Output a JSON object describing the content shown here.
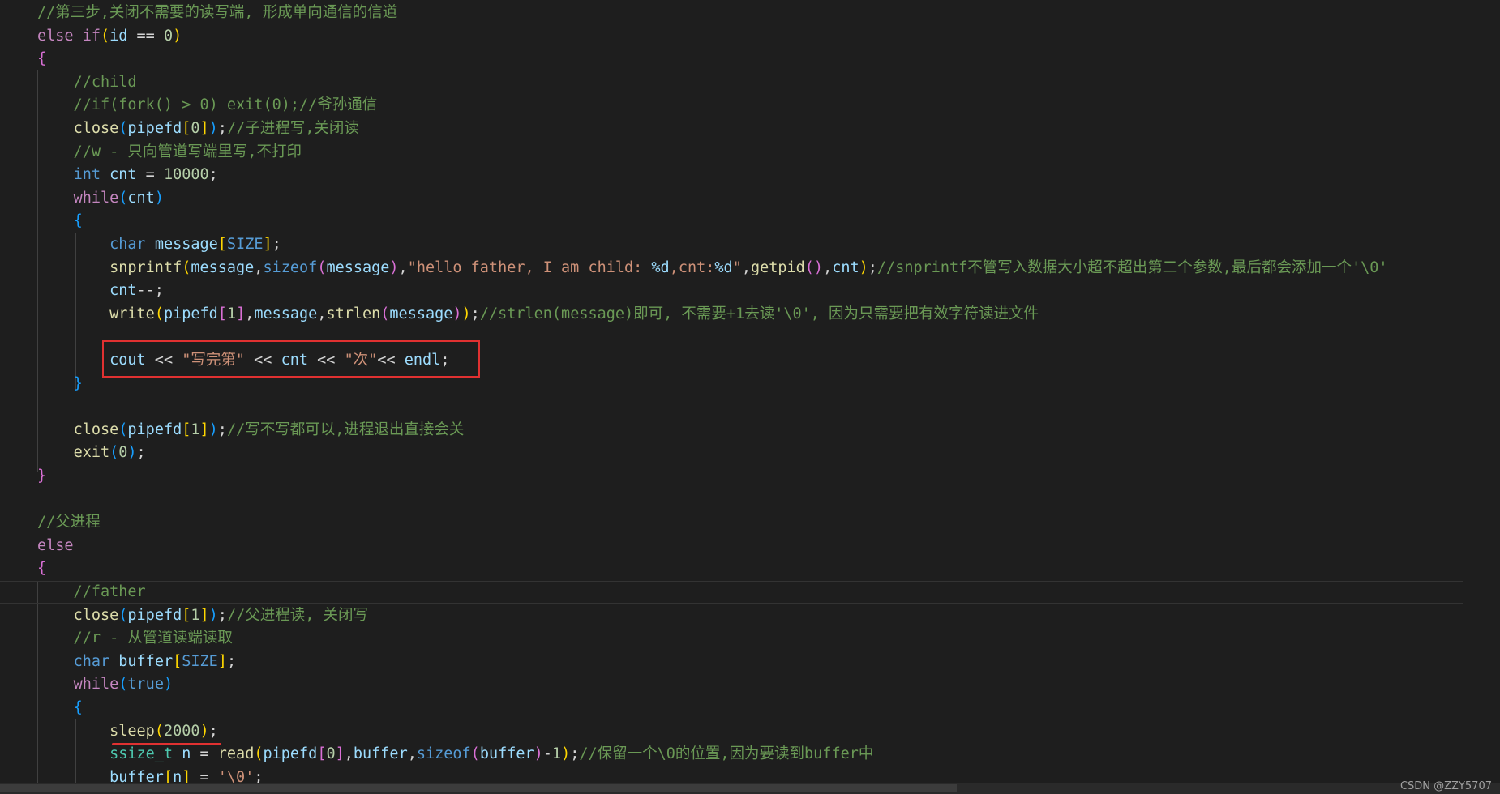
{
  "lines": [
    [
      {
        "t": "//第三步,关闭不需要的读写端, 形成单向通信的信道",
        "c": "comment"
      }
    ],
    [
      {
        "t": "else ",
        "c": "control"
      },
      {
        "t": "if",
        "c": "control"
      },
      {
        "t": "(",
        "c": "b1"
      },
      {
        "t": "id",
        "c": "var"
      },
      {
        "t": " == ",
        "c": "plain"
      },
      {
        "t": "0",
        "c": "number"
      },
      {
        "t": ")",
        "c": "b1"
      }
    ],
    [
      {
        "t": "{",
        "c": "b2"
      }
    ],
    [
      {
        "t": "    //child",
        "c": "comment"
      }
    ],
    [
      {
        "t": "    //if(fork() > 0) exit(0);//爷孙通信",
        "c": "comment"
      }
    ],
    [
      {
        "t": "    ",
        "c": "plain"
      },
      {
        "t": "close",
        "c": "func"
      },
      {
        "t": "(",
        "c": "b3"
      },
      {
        "t": "pipefd",
        "c": "var"
      },
      {
        "t": "[",
        "c": "b1"
      },
      {
        "t": "0",
        "c": "number"
      },
      {
        "t": "]",
        "c": "b1"
      },
      {
        "t": ")",
        "c": "b3"
      },
      {
        "t": ";",
        "c": "plain"
      },
      {
        "t": "//子进程写,关闭读",
        "c": "comment"
      }
    ],
    [
      {
        "t": "    //w - 只向管道写端里写,不打印",
        "c": "comment"
      }
    ],
    [
      {
        "t": "    ",
        "c": "plain"
      },
      {
        "t": "int",
        "c": "keyword"
      },
      {
        "t": " ",
        "c": "plain"
      },
      {
        "t": "cnt",
        "c": "var"
      },
      {
        "t": " = ",
        "c": "plain"
      },
      {
        "t": "10000",
        "c": "number"
      },
      {
        "t": ";",
        "c": "plain"
      }
    ],
    [
      {
        "t": "    ",
        "c": "plain"
      },
      {
        "t": "while",
        "c": "control"
      },
      {
        "t": "(",
        "c": "b3"
      },
      {
        "t": "cnt",
        "c": "var"
      },
      {
        "t": ")",
        "c": "b3"
      }
    ],
    [
      {
        "t": "    ",
        "c": "plain"
      },
      {
        "t": "{",
        "c": "b3"
      }
    ],
    [
      {
        "t": "        ",
        "c": "plain"
      },
      {
        "t": "char",
        "c": "keyword"
      },
      {
        "t": " ",
        "c": "plain"
      },
      {
        "t": "message",
        "c": "var"
      },
      {
        "t": "[",
        "c": "b1"
      },
      {
        "t": "SIZE",
        "c": "keyword"
      },
      {
        "t": "]",
        "c": "b1"
      },
      {
        "t": ";",
        "c": "plain"
      }
    ],
    [
      {
        "t": "        ",
        "c": "plain"
      },
      {
        "t": "snprintf",
        "c": "func"
      },
      {
        "t": "(",
        "c": "b1"
      },
      {
        "t": "message",
        "c": "var"
      },
      {
        "t": ",",
        "c": "plain"
      },
      {
        "t": "sizeof",
        "c": "keyword"
      },
      {
        "t": "(",
        "c": "b2"
      },
      {
        "t": "message",
        "c": "var"
      },
      {
        "t": ")",
        "c": "b2"
      },
      {
        "t": ",",
        "c": "plain"
      },
      {
        "t": "\"hello father, I am child: ",
        "c": "string"
      },
      {
        "t": "%d",
        "c": "fmt"
      },
      {
        "t": ",cnt:",
        "c": "string"
      },
      {
        "t": "%d",
        "c": "fmt"
      },
      {
        "t": "\"",
        "c": "string"
      },
      {
        "t": ",",
        "c": "plain"
      },
      {
        "t": "getpid",
        "c": "func"
      },
      {
        "t": "()",
        "c": "b2"
      },
      {
        "t": ",",
        "c": "plain"
      },
      {
        "t": "cnt",
        "c": "var"
      },
      {
        "t": ")",
        "c": "b1"
      },
      {
        "t": ";",
        "c": "plain"
      },
      {
        "t": "//snprintf不管写入数据大小超不超出第二个参数,最后都会添加一个'\\0'",
        "c": "comment"
      }
    ],
    [
      {
        "t": "        ",
        "c": "plain"
      },
      {
        "t": "cnt",
        "c": "var"
      },
      {
        "t": "--;",
        "c": "plain"
      }
    ],
    [
      {
        "t": "        ",
        "c": "plain"
      },
      {
        "t": "write",
        "c": "func"
      },
      {
        "t": "(",
        "c": "b1"
      },
      {
        "t": "pipefd",
        "c": "var"
      },
      {
        "t": "[",
        "c": "b2"
      },
      {
        "t": "1",
        "c": "number"
      },
      {
        "t": "]",
        "c": "b2"
      },
      {
        "t": ",",
        "c": "plain"
      },
      {
        "t": "message",
        "c": "var"
      },
      {
        "t": ",",
        "c": "plain"
      },
      {
        "t": "strlen",
        "c": "func"
      },
      {
        "t": "(",
        "c": "b2"
      },
      {
        "t": "message",
        "c": "var"
      },
      {
        "t": ")",
        "c": "b2"
      },
      {
        "t": ")",
        "c": "b1"
      },
      {
        "t": ";",
        "c": "plain"
      },
      {
        "t": "//strlen(message)即可, 不需要+1去读'\\0', 因为只需要把有效字符读进文件",
        "c": "comment"
      }
    ],
    [],
    [
      {
        "t": "        ",
        "c": "plain"
      },
      {
        "t": "cout",
        "c": "var"
      },
      {
        "t": " << ",
        "c": "plain"
      },
      {
        "t": "\"写完第\"",
        "c": "string"
      },
      {
        "t": " << ",
        "c": "plain"
      },
      {
        "t": "cnt",
        "c": "var"
      },
      {
        "t": " << ",
        "c": "plain"
      },
      {
        "t": "\"次\"",
        "c": "string"
      },
      {
        "t": "<< ",
        "c": "plain"
      },
      {
        "t": "endl",
        "c": "var"
      },
      {
        "t": ";",
        "c": "plain"
      }
    ],
    [
      {
        "t": "    ",
        "c": "plain"
      },
      {
        "t": "}",
        "c": "b3"
      }
    ],
    [],
    [
      {
        "t": "    ",
        "c": "plain"
      },
      {
        "t": "close",
        "c": "func"
      },
      {
        "t": "(",
        "c": "b3"
      },
      {
        "t": "pipefd",
        "c": "var"
      },
      {
        "t": "[",
        "c": "b1"
      },
      {
        "t": "1",
        "c": "number"
      },
      {
        "t": "]",
        "c": "b1"
      },
      {
        "t": ")",
        "c": "b3"
      },
      {
        "t": ";",
        "c": "plain"
      },
      {
        "t": "//写不写都可以,进程退出直接会关",
        "c": "comment"
      }
    ],
    [
      {
        "t": "    ",
        "c": "plain"
      },
      {
        "t": "exit",
        "c": "func"
      },
      {
        "t": "(",
        "c": "b3"
      },
      {
        "t": "0",
        "c": "number"
      },
      {
        "t": ")",
        "c": "b3"
      },
      {
        "t": ";",
        "c": "plain"
      }
    ],
    [
      {
        "t": "}",
        "c": "b2"
      }
    ],
    [],
    [
      {
        "t": "//父进程",
        "c": "comment"
      }
    ],
    [
      {
        "t": "else",
        "c": "control"
      }
    ],
    [
      {
        "t": "{",
        "c": "b2"
      }
    ],
    [
      {
        "t": "    //father",
        "c": "comment"
      }
    ],
    [
      {
        "t": "    ",
        "c": "plain"
      },
      {
        "t": "close",
        "c": "func"
      },
      {
        "t": "(",
        "c": "b3"
      },
      {
        "t": "pipefd",
        "c": "var"
      },
      {
        "t": "[",
        "c": "b1"
      },
      {
        "t": "1",
        "c": "number"
      },
      {
        "t": "]",
        "c": "b1"
      },
      {
        "t": ")",
        "c": "b3"
      },
      {
        "t": ";",
        "c": "plain"
      },
      {
        "t": "//父进程读, 关闭写",
        "c": "comment"
      }
    ],
    [
      {
        "t": "    //r - 从管道读端读取",
        "c": "comment"
      }
    ],
    [
      {
        "t": "    ",
        "c": "plain"
      },
      {
        "t": "char",
        "c": "keyword"
      },
      {
        "t": " ",
        "c": "plain"
      },
      {
        "t": "buffer",
        "c": "var"
      },
      {
        "t": "[",
        "c": "b1"
      },
      {
        "t": "SIZE",
        "c": "keyword"
      },
      {
        "t": "]",
        "c": "b1"
      },
      {
        "t": ";",
        "c": "plain"
      }
    ],
    [
      {
        "t": "    ",
        "c": "plain"
      },
      {
        "t": "while",
        "c": "control"
      },
      {
        "t": "(",
        "c": "b3"
      },
      {
        "t": "true",
        "c": "keyword"
      },
      {
        "t": ")",
        "c": "b3"
      }
    ],
    [
      {
        "t": "    ",
        "c": "plain"
      },
      {
        "t": "{",
        "c": "b3"
      }
    ],
    [
      {
        "t": "        ",
        "c": "plain"
      },
      {
        "t": "sleep",
        "c": "func"
      },
      {
        "t": "(",
        "c": "b1"
      },
      {
        "t": "2000",
        "c": "number"
      },
      {
        "t": ")",
        "c": "b1"
      },
      {
        "t": ";",
        "c": "plain"
      }
    ],
    [
      {
        "t": "        ",
        "c": "plain"
      },
      {
        "t": "ssize_t",
        "c": "type"
      },
      {
        "t": " ",
        "c": "plain"
      },
      {
        "t": "n",
        "c": "var"
      },
      {
        "t": " = ",
        "c": "plain"
      },
      {
        "t": "read",
        "c": "func"
      },
      {
        "t": "(",
        "c": "b1"
      },
      {
        "t": "pipefd",
        "c": "var"
      },
      {
        "t": "[",
        "c": "b2"
      },
      {
        "t": "0",
        "c": "number"
      },
      {
        "t": "]",
        "c": "b2"
      },
      {
        "t": ",",
        "c": "plain"
      },
      {
        "t": "buffer",
        "c": "var"
      },
      {
        "t": ",",
        "c": "plain"
      },
      {
        "t": "sizeof",
        "c": "keyword"
      },
      {
        "t": "(",
        "c": "b2"
      },
      {
        "t": "buffer",
        "c": "var"
      },
      {
        "t": ")",
        "c": "b2"
      },
      {
        "t": "-",
        "c": "plain"
      },
      {
        "t": "1",
        "c": "number"
      },
      {
        "t": ")",
        "c": "b1"
      },
      {
        "t": ";",
        "c": "plain"
      },
      {
        "t": "//保留一个\\0的位置,因为要读到buffer中",
        "c": "comment"
      }
    ],
    [
      {
        "t": "        ",
        "c": "plain"
      },
      {
        "t": "buffer",
        "c": "var"
      },
      {
        "t": "[",
        "c": "b1"
      },
      {
        "t": "n",
        "c": "var"
      },
      {
        "t": "]",
        "c": "b1"
      },
      {
        "t": " = ",
        "c": "plain"
      },
      {
        "t": "'\\0'",
        "c": "string"
      },
      {
        "t": ";",
        "c": "plain"
      }
    ]
  ],
  "current_line_index": 25,
  "watermark": "CSDN @ZZY5707"
}
